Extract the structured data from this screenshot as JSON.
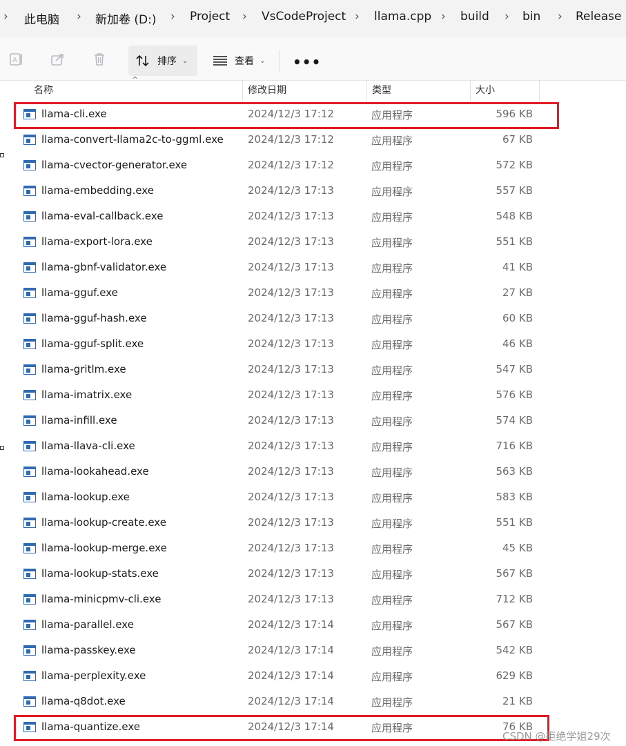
{
  "breadcrumb": {
    "parts": [
      "此电脑",
      "新加卷 (D:)",
      "Project",
      "VsCodeProject",
      "llama.cpp",
      "build",
      "bin",
      "Release"
    ],
    "separator": "›"
  },
  "toolbar": {
    "sort_label": "排序",
    "view_label": "查看",
    "more_label": "•••"
  },
  "columns": {
    "name": "名称",
    "date": "修改日期",
    "type": "类型",
    "size": "大小"
  },
  "files": [
    {
      "name": "llama-cli.exe",
      "date": "2024/12/3 17:12",
      "type": "应用程序",
      "size": "596 KB",
      "highlighted": true
    },
    {
      "name": "llama-convert-llama2c-to-ggml.exe",
      "date": "2024/12/3 17:12",
      "type": "应用程序",
      "size": "67 KB"
    },
    {
      "name": "llama-cvector-generator.exe",
      "date": "2024/12/3 17:12",
      "type": "应用程序",
      "size": "572 KB"
    },
    {
      "name": "llama-embedding.exe",
      "date": "2024/12/3 17:13",
      "type": "应用程序",
      "size": "557 KB"
    },
    {
      "name": "llama-eval-callback.exe",
      "date": "2024/12/3 17:13",
      "type": "应用程序",
      "size": "548 KB"
    },
    {
      "name": "llama-export-lora.exe",
      "date": "2024/12/3 17:13",
      "type": "应用程序",
      "size": "551 KB"
    },
    {
      "name": "llama-gbnf-validator.exe",
      "date": "2024/12/3 17:13",
      "type": "应用程序",
      "size": "41 KB"
    },
    {
      "name": "llama-gguf.exe",
      "date": "2024/12/3 17:13",
      "type": "应用程序",
      "size": "27 KB"
    },
    {
      "name": "llama-gguf-hash.exe",
      "date": "2024/12/3 17:13",
      "type": "应用程序",
      "size": "60 KB"
    },
    {
      "name": "llama-gguf-split.exe",
      "date": "2024/12/3 17:13",
      "type": "应用程序",
      "size": "46 KB"
    },
    {
      "name": "llama-gritlm.exe",
      "date": "2024/12/3 17:13",
      "type": "应用程序",
      "size": "547 KB"
    },
    {
      "name": "llama-imatrix.exe",
      "date": "2024/12/3 17:13",
      "type": "应用程序",
      "size": "576 KB"
    },
    {
      "name": "llama-infill.exe",
      "date": "2024/12/3 17:13",
      "type": "应用程序",
      "size": "574 KB"
    },
    {
      "name": "llama-llava-cli.exe",
      "date": "2024/12/3 17:13",
      "type": "应用程序",
      "size": "716 KB"
    },
    {
      "name": "llama-lookahead.exe",
      "date": "2024/12/3 17:13",
      "type": "应用程序",
      "size": "563 KB"
    },
    {
      "name": "llama-lookup.exe",
      "date": "2024/12/3 17:13",
      "type": "应用程序",
      "size": "583 KB"
    },
    {
      "name": "llama-lookup-create.exe",
      "date": "2024/12/3 17:13",
      "type": "应用程序",
      "size": "551 KB"
    },
    {
      "name": "llama-lookup-merge.exe",
      "date": "2024/12/3 17:13",
      "type": "应用程序",
      "size": "45 KB"
    },
    {
      "name": "llama-lookup-stats.exe",
      "date": "2024/12/3 17:13",
      "type": "应用程序",
      "size": "567 KB"
    },
    {
      "name": "llama-minicpmv-cli.exe",
      "date": "2024/12/3 17:13",
      "type": "应用程序",
      "size": "712 KB"
    },
    {
      "name": "llama-parallel.exe",
      "date": "2024/12/3 17:14",
      "type": "应用程序",
      "size": "567 KB"
    },
    {
      "name": "llama-passkey.exe",
      "date": "2024/12/3 17:14",
      "type": "应用程序",
      "size": "542 KB"
    },
    {
      "name": "llama-perplexity.exe",
      "date": "2024/12/3 17:14",
      "type": "应用程序",
      "size": "629 KB"
    },
    {
      "name": "llama-q8dot.exe",
      "date": "2024/12/3 17:14",
      "type": "应用程序",
      "size": "21 KB"
    },
    {
      "name": "llama-quantize.exe",
      "date": "2024/12/3 17:14",
      "type": "应用程序",
      "size": "76 KB",
      "highlighted": true
    }
  ],
  "icons": {
    "rename": "rename-icon",
    "share": "share-icon",
    "delete": "delete-icon",
    "sort": "sort-icon",
    "view": "view-icon",
    "file": "exe-file-icon"
  },
  "colors": {
    "highlight": "#e01b24",
    "exe_icon": "#2f6ab3"
  },
  "watermark": "CSDN @拒绝学姐29次"
}
